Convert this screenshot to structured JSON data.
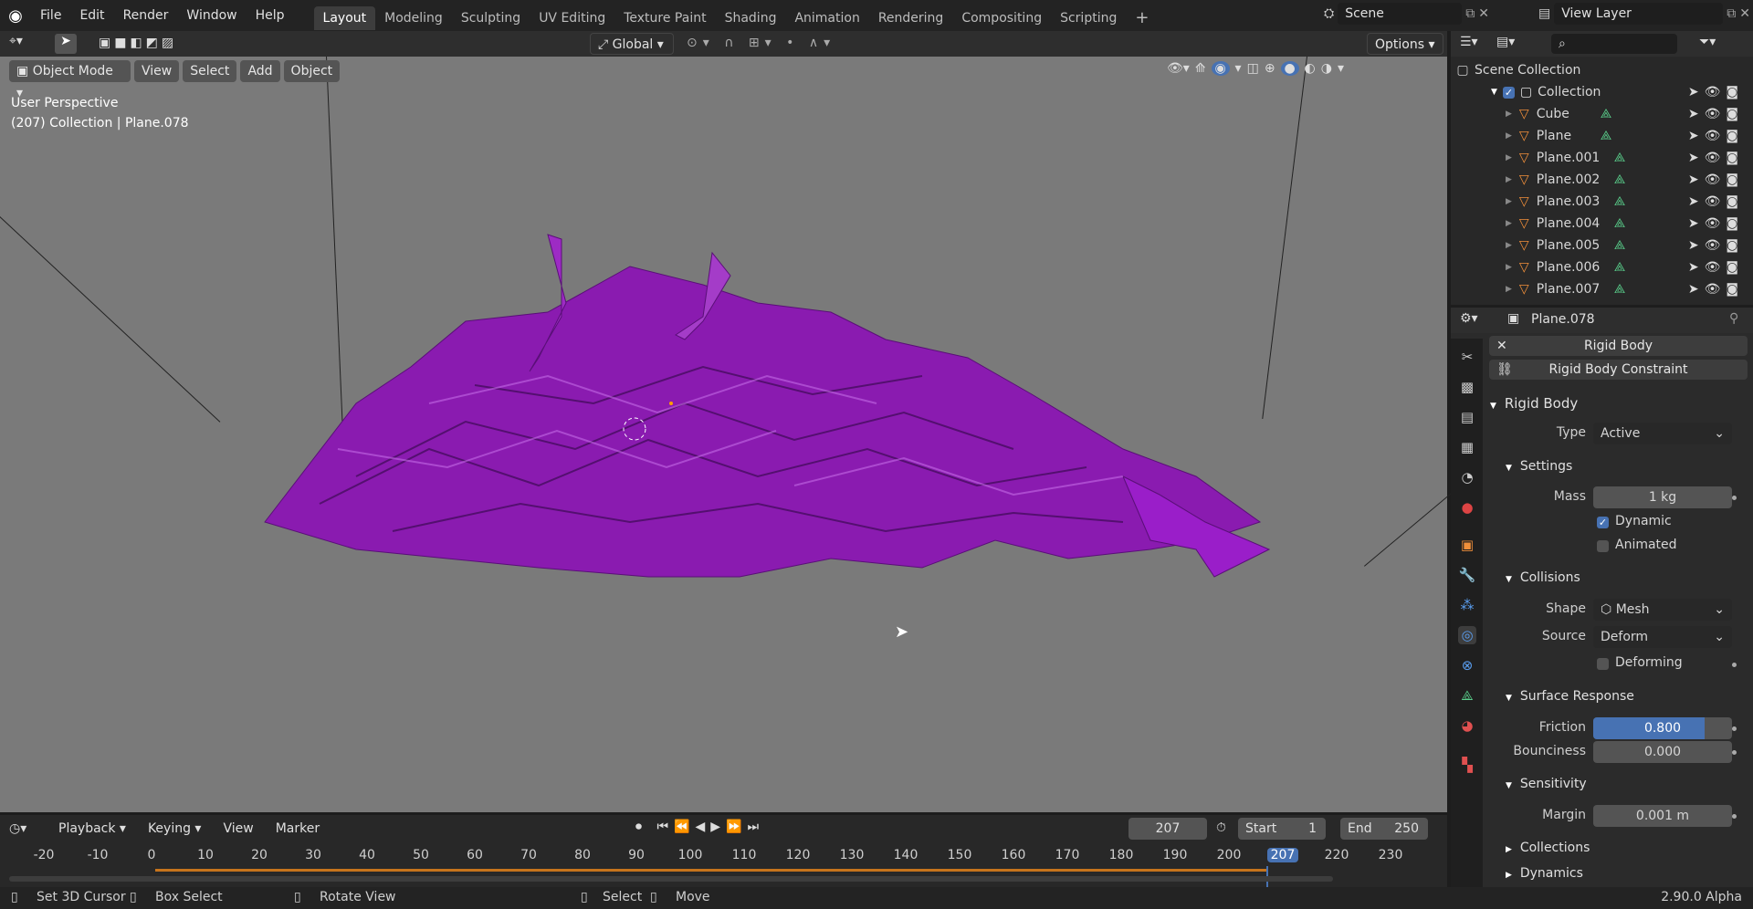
{
  "topbar": {
    "menus": [
      "File",
      "Edit",
      "Render",
      "Window",
      "Help"
    ],
    "workspaces": [
      "Layout",
      "Modeling",
      "Sculpting",
      "UV Editing",
      "Texture Paint",
      "Shading",
      "Animation",
      "Rendering",
      "Compositing",
      "Scripting"
    ],
    "active_workspace": "Layout",
    "add_tab": "+",
    "scene": "Scene",
    "view_layer": "View Layer"
  },
  "tool_header": {
    "orientation": "Global",
    "options": "Options"
  },
  "viewport_header": {
    "mode": "Object Mode",
    "menus": [
      "View",
      "Select",
      "Add",
      "Object"
    ]
  },
  "viewport": {
    "line1": "User Perspective",
    "line2": "(207) Collection | Plane.078",
    "mesh_color": "#8a1bb0"
  },
  "outliner": {
    "scene_collection": "Scene Collection",
    "collection": "Collection",
    "items": [
      "Cube",
      "Plane",
      "Plane.001",
      "Plane.002",
      "Plane.003",
      "Plane.004",
      "Plane.005",
      "Plane.006",
      "Plane.007"
    ]
  },
  "properties": {
    "object": "Plane.078",
    "rigid_body_btn": "Rigid Body",
    "constraint_btn": "Rigid Body Constraint",
    "panel": "Rigid Body",
    "type_label": "Type",
    "type_value": "Active",
    "settings": "Settings",
    "mass_label": "Mass",
    "mass_value": "1 kg",
    "dynamic": "Dynamic",
    "animated": "Animated",
    "collisions": "Collisions",
    "shape_label": "Shape",
    "shape_value": "Mesh",
    "source_label": "Source",
    "source_value": "Deform",
    "deforming": "Deforming",
    "surface": "Surface Response",
    "friction_label": "Friction",
    "friction_value": "0.800",
    "friction_level": 0.8,
    "bounciness_label": "Bounciness",
    "bounciness_value": "0.000",
    "sensitivity": "Sensitivity",
    "margin_label": "Margin",
    "margin_value": "0.001 m",
    "sub_collections": "Collections",
    "dynamics": "Dynamics"
  },
  "timeline": {
    "menus": [
      "Playback",
      "Keying",
      "View",
      "Marker"
    ],
    "current": "207",
    "start_label": "Start",
    "start": "1",
    "end_label": "End",
    "end": "250",
    "ticks": [
      "-20",
      "-10",
      "0",
      "10",
      "20",
      "30",
      "40",
      "50",
      "60",
      "70",
      "80",
      "90",
      "100",
      "110",
      "120",
      "130",
      "140",
      "150",
      "160",
      "170",
      "180",
      "190",
      "200",
      "207",
      "220",
      "230"
    ]
  },
  "status": {
    "items": [
      "Set 3D Cursor",
      "Box Select",
      "Rotate View",
      "Select",
      "Move"
    ],
    "version": "2.90.0 Alpha"
  }
}
